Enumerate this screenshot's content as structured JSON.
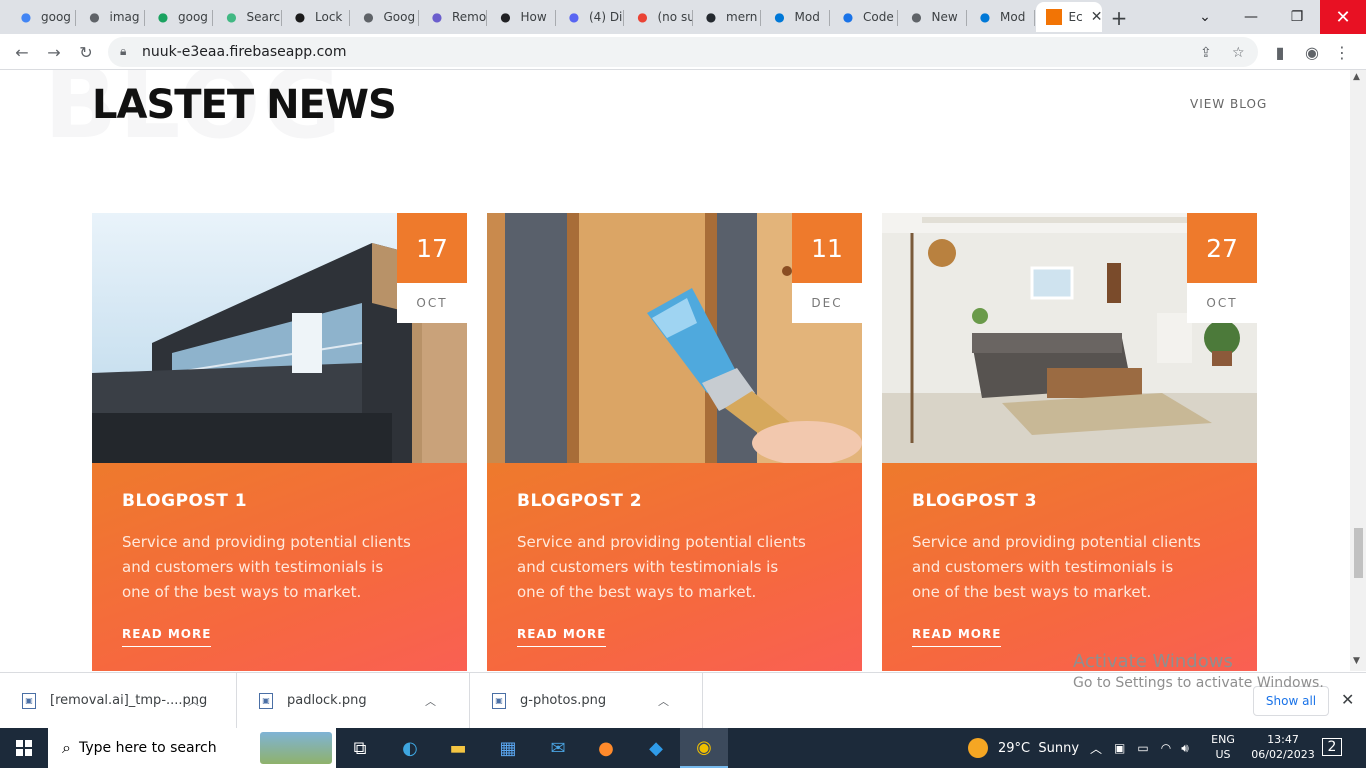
{
  "tabs": [
    {
      "label": "goog",
      "icon": "google-icon",
      "color": "#4285f4"
    },
    {
      "label": "imag",
      "icon": "globe-icon",
      "color": "#5f6368"
    },
    {
      "label": "goog",
      "icon": "bolt-icon",
      "color": "#1aa260"
    },
    {
      "label": "Searc",
      "icon": "vue-icon",
      "color": "#41b883"
    },
    {
      "label": "Lock",
      "icon": "st-icon",
      "color": "#1b1b1b"
    },
    {
      "label": "Goog",
      "icon": "globe-icon",
      "color": "#5f6368"
    },
    {
      "label": "Remo",
      "icon": "remove-icon",
      "color": "#6b5ecd"
    },
    {
      "label": "How",
      "icon": "terminal-icon",
      "color": "#202124"
    },
    {
      "label": "(4) Di",
      "icon": "discord-icon",
      "color": "#5865f2"
    },
    {
      "label": "(no su",
      "icon": "gmail-icon",
      "color": "#ea4335"
    },
    {
      "label": "mern",
      "icon": "github-icon",
      "color": "#24292f"
    },
    {
      "label": "Mod",
      "icon": "edge-e-icon",
      "color": "#0078d7"
    },
    {
      "label": "Code",
      "icon": "codepen-c-icon",
      "color": "#1a73e8"
    },
    {
      "label": "New",
      "icon": "chrome-icon",
      "color": "#5f6368"
    },
    {
      "label": "Mod",
      "icon": "edge-e-icon",
      "color": "#0078d7"
    },
    {
      "label": "Ec",
      "icon": "orange-square-icon",
      "color": "#f27405"
    }
  ],
  "address": {
    "url": "nuuk-e3eaa.firebaseapp.com"
  },
  "section": {
    "bg_word": "BLOG",
    "title": "LASTET NEWS",
    "view_link": "VIEW BLOG"
  },
  "posts": [
    {
      "day": "17",
      "month": "OCT",
      "title": "BLOGPOST 1",
      "excerpt": "Service and providing potential clients and customers with testimonials is one of the best ways to market.",
      "more": "READ MORE"
    },
    {
      "day": "11",
      "month": "DEC",
      "title": "BLOGPOST 2",
      "excerpt": "Service and providing potential clients and customers with testimonials is one of the best ways to market.",
      "more": "READ MORE"
    },
    {
      "day": "27",
      "month": "OCT",
      "title": "BLOGPOST 3",
      "excerpt": "Service and providing potential clients and customers with testimonials is one of the best ways to market.",
      "more": "READ MORE"
    }
  ],
  "watermark": {
    "line1": "Activate Windows",
    "line2": "Go to Settings to activate Windows."
  },
  "downloads": {
    "items": [
      {
        "name": "[removal.ai]_tmp-....png"
      },
      {
        "name": "padlock.png"
      },
      {
        "name": "g-photos.png"
      }
    ],
    "show_all": "Show all"
  },
  "taskbar": {
    "search_placeholder": "Type here to search",
    "weather_temp": "29°C",
    "weather_desc": "Sunny",
    "lang_line1": "ENG",
    "lang_line2": "US",
    "time": "13:47",
    "date": "06/02/2023",
    "notifications": "2"
  },
  "colors": {
    "accent": "#ee7a2c",
    "accent_end": "#fa5f55"
  }
}
